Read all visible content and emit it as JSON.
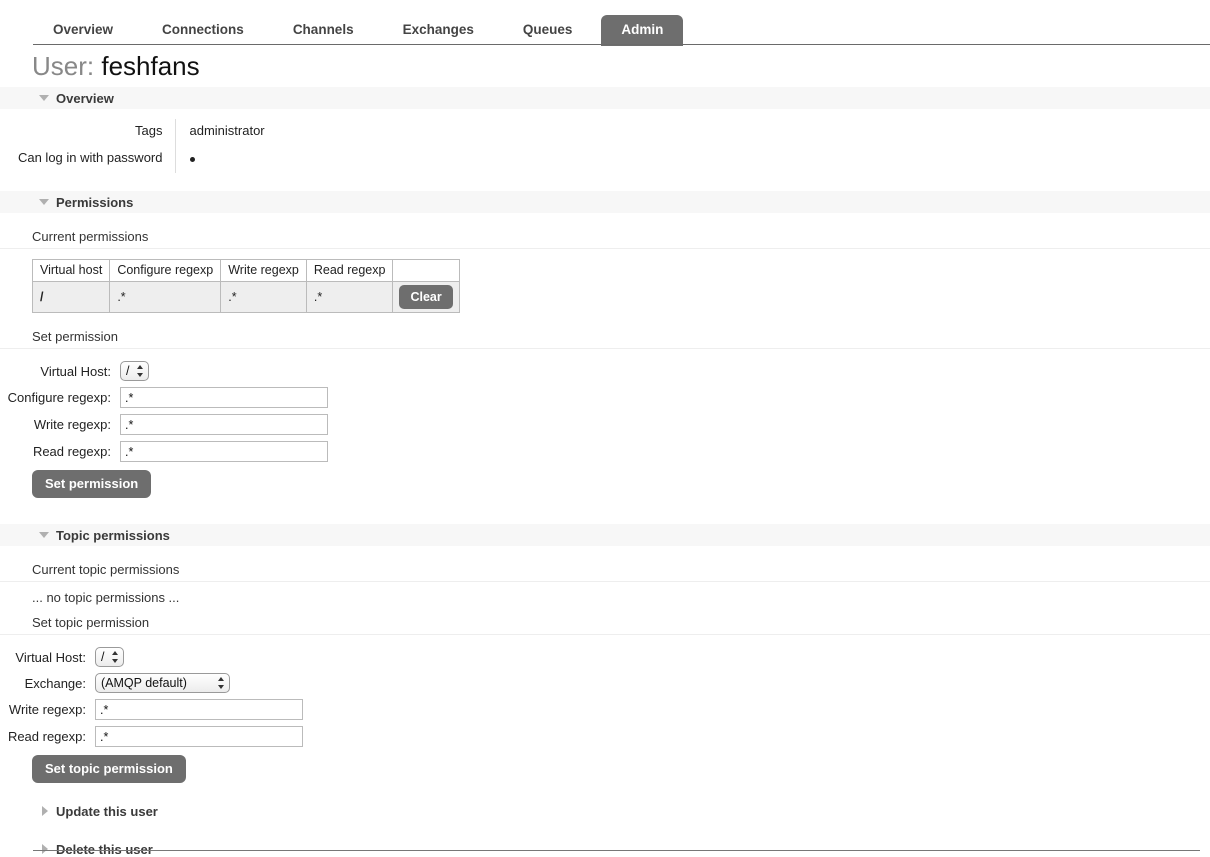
{
  "nav": {
    "tabs": [
      {
        "label": "Overview",
        "active": false
      },
      {
        "label": "Connections",
        "active": false
      },
      {
        "label": "Channels",
        "active": false
      },
      {
        "label": "Exchanges",
        "active": false
      },
      {
        "label": "Queues",
        "active": false
      },
      {
        "label": "Admin",
        "active": true
      }
    ]
  },
  "page": {
    "title_label": "User:",
    "title_name": "feshfans"
  },
  "overview": {
    "section_label": "Overview",
    "rows": [
      {
        "key": "Tags",
        "value": "administrator"
      },
      {
        "key": "Can log in with password",
        "value": "•"
      }
    ]
  },
  "permissions": {
    "section_label": "Permissions",
    "current_label": "Current permissions",
    "table": {
      "headers": [
        "Virtual host",
        "Configure regexp",
        "Write regexp",
        "Read regexp",
        ""
      ],
      "rows": [
        {
          "vhost": "/",
          "configure": ".*",
          "write": ".*",
          "read": ".*",
          "action_label": "Clear"
        }
      ]
    },
    "set_label": "Set permission",
    "form": {
      "vhost_label": "Virtual Host:",
      "vhost_value": "/",
      "vhost_options": [
        "/"
      ],
      "configure_label": "Configure regexp:",
      "configure_value": ".*",
      "write_label": "Write regexp:",
      "write_value": ".*",
      "read_label": "Read regexp:",
      "read_value": ".*",
      "submit_label": "Set permission"
    }
  },
  "topic_permissions": {
    "section_label": "Topic permissions",
    "current_label": "Current topic permissions",
    "empty_text": "... no topic permissions ...",
    "set_label": "Set topic permission",
    "form": {
      "vhost_label": "Virtual Host:",
      "vhost_value": "/",
      "vhost_options": [
        "/"
      ],
      "exchange_label": "Exchange:",
      "exchange_value": "(AMQP default)",
      "exchange_options": [
        "(AMQP default)"
      ],
      "write_label": "Write regexp:",
      "write_value": ".*",
      "read_label": "Read regexp:",
      "read_value": ".*",
      "submit_label": "Set topic permission"
    }
  },
  "footer_sections": [
    {
      "label": "Update this user"
    },
    {
      "label": "Delete this user"
    }
  ],
  "colors": {
    "accent": "#6e6e6e",
    "section_bg": "#f7f7f7",
    "table_row_bg": "#eeeeee",
    "border": "#bbbbbb"
  }
}
